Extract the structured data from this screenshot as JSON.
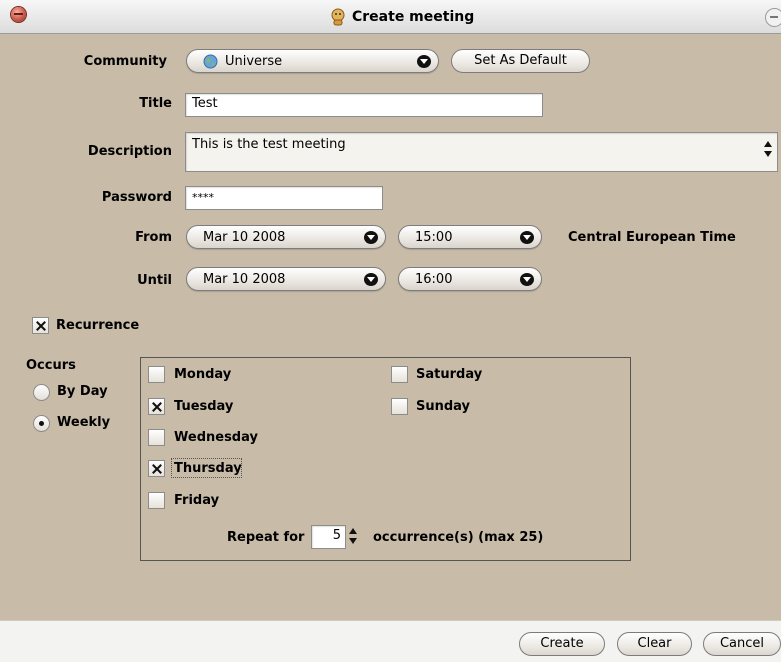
{
  "window": {
    "title": "Create meeting"
  },
  "community": {
    "label": "Community",
    "value": "Universe",
    "set_default_label": "Set As Default"
  },
  "title_field": {
    "label": "Title",
    "value": "Test"
  },
  "description": {
    "label": "Description",
    "value": "This is the test meeting"
  },
  "password": {
    "label": "Password",
    "value": "****"
  },
  "from": {
    "label": "From",
    "date": "Mar 10 2008",
    "time": "15:00",
    "timezone": "Central European Time"
  },
  "until": {
    "label": "Until",
    "date": "Mar 10 2008",
    "time": "16:00"
  },
  "recurrence": {
    "label": "Recurrence",
    "checked": true
  },
  "occurs": {
    "label": "Occurs",
    "options": [
      {
        "label": "By Day",
        "selected": false
      },
      {
        "label": "Weekly",
        "selected": true
      }
    ]
  },
  "days": [
    {
      "label": "Monday",
      "checked": false
    },
    {
      "label": "Tuesday",
      "checked": true
    },
    {
      "label": "Wednesday",
      "checked": false
    },
    {
      "label": "Thursday",
      "checked": true
    },
    {
      "label": "Friday",
      "checked": false
    },
    {
      "label": "Saturday",
      "checked": false
    },
    {
      "label": "Sunday",
      "checked": false
    }
  ],
  "repeat": {
    "label": "Repeat for",
    "value": "5",
    "suffix": "occurrence(s) (max 25)"
  },
  "buttons": {
    "create": "Create",
    "clear": "Clear",
    "cancel": "Cancel"
  },
  "colors": {
    "window_bg": "#c8bca9",
    "bottom_bar": "#f3f3f1"
  }
}
